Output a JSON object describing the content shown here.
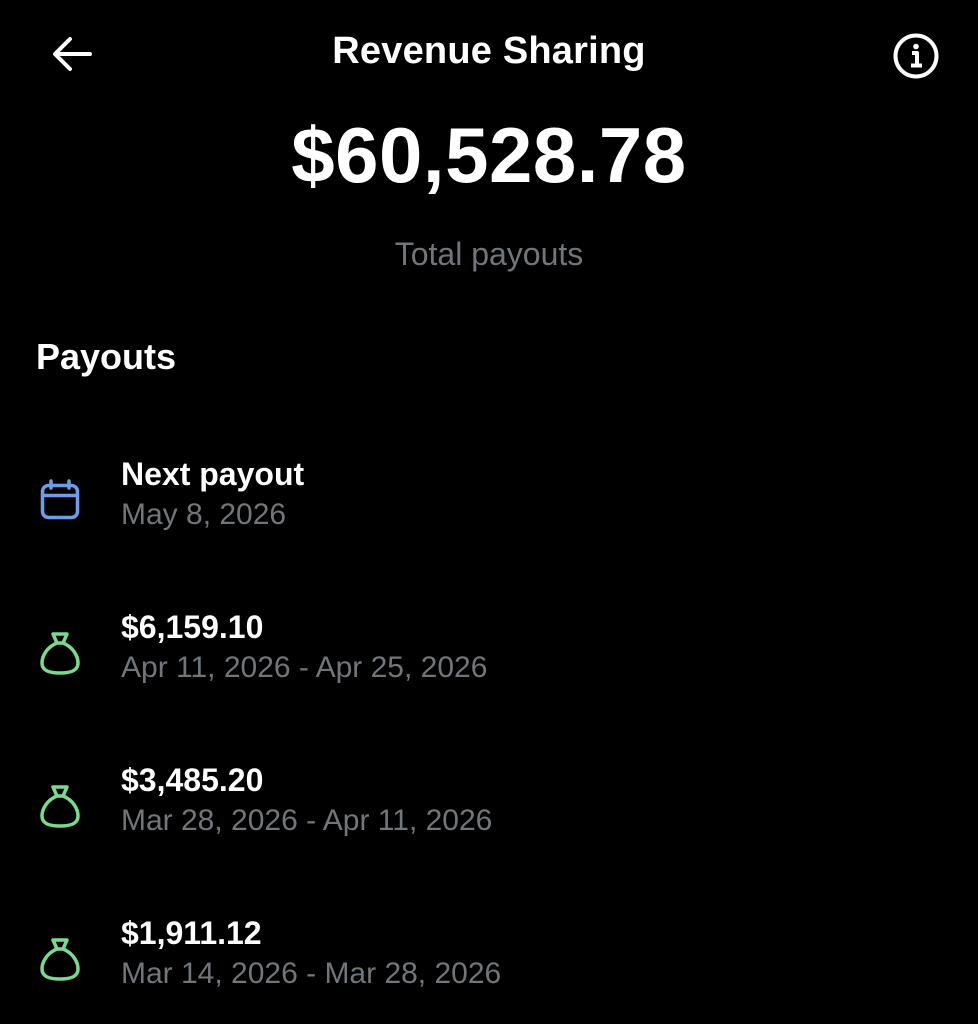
{
  "header": {
    "title": "Revenue Sharing"
  },
  "summary": {
    "total_amount": "$60,528.78",
    "total_label": "Total payouts"
  },
  "payouts": {
    "section_title": "Payouts",
    "next": {
      "title": "Next payout",
      "date": "May 8, 2026",
      "icon": "calendar-icon"
    },
    "items": [
      {
        "amount": "$6,159.10",
        "period": "Apr 11, 2026 - Apr 25, 2026",
        "icon": "money-bag-icon"
      },
      {
        "amount": "$3,485.20",
        "period": "Mar 28, 2026 - Apr 11, 2026",
        "icon": "money-bag-icon"
      },
      {
        "amount": "$1,911.12",
        "period": "Mar 14, 2026 - Mar 28, 2026",
        "icon": "money-bag-icon"
      }
    ]
  },
  "colors": {
    "background": "#000000",
    "text_primary": "#ffffff",
    "text_secondary": "#71767b",
    "calendar_icon": "#6f9ee8",
    "money_icon": "#7bd88f"
  }
}
